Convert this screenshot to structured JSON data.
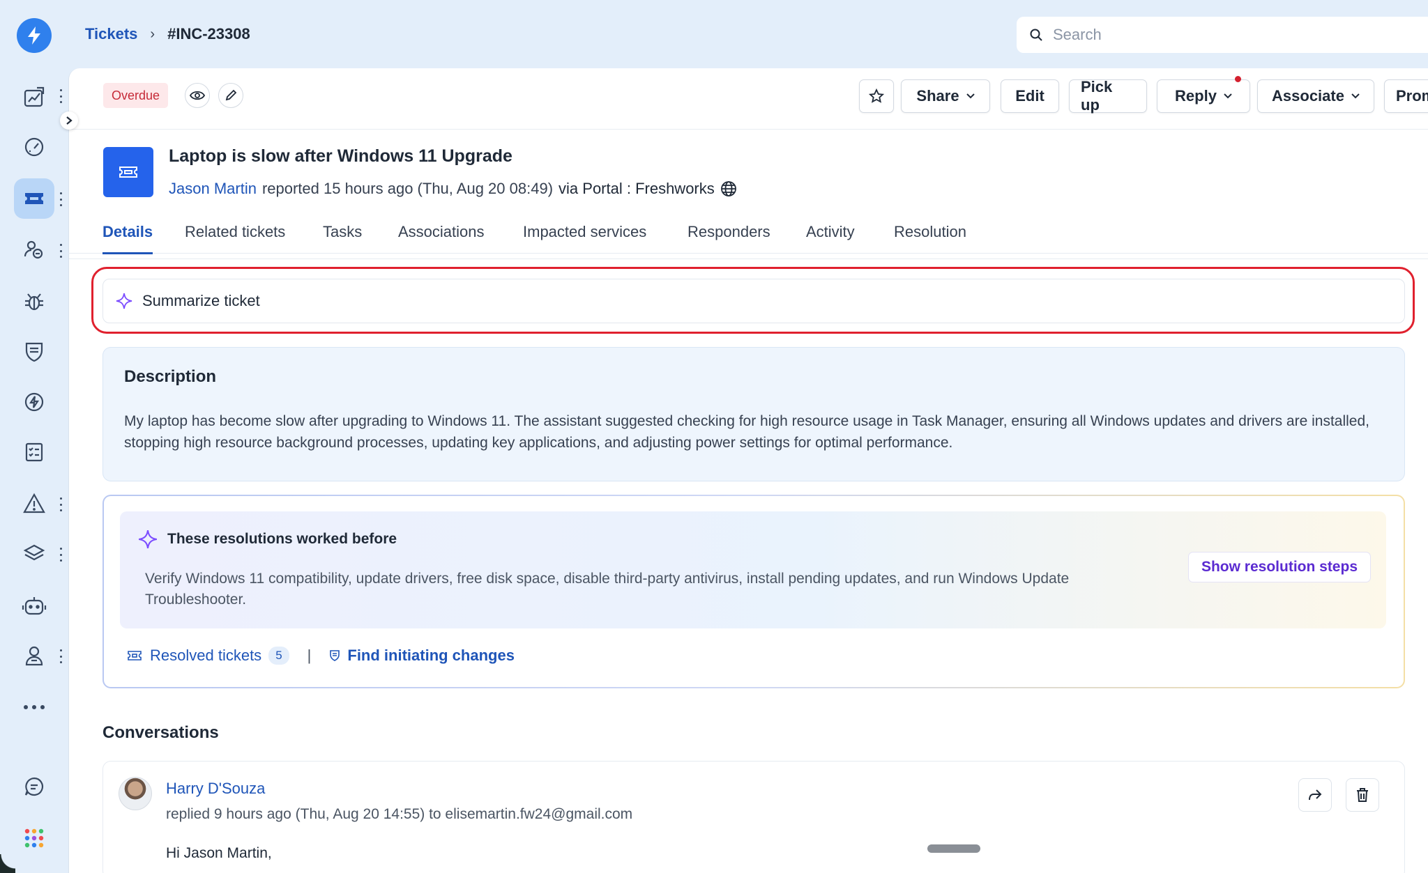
{
  "breadcrumb": {
    "root": "Tickets",
    "separator": "›",
    "current": "#INC-23308"
  },
  "search": {
    "placeholder": "Search"
  },
  "sidebar": {
    "items": [
      {
        "icon": "analytics-icon"
      },
      {
        "icon": "dashboard-icon"
      },
      {
        "icon": "tickets-icon"
      },
      {
        "icon": "users-icon"
      },
      {
        "icon": "problems-icon"
      },
      {
        "icon": "changes-icon"
      },
      {
        "icon": "releases-icon"
      },
      {
        "icon": "tasks-icon"
      },
      {
        "icon": "incidents-icon"
      },
      {
        "icon": "assets-icon"
      },
      {
        "icon": "bot-icon"
      },
      {
        "icon": "solutions-icon"
      },
      {
        "icon": "more-icon"
      },
      {
        "icon": "chat-icon"
      },
      {
        "icon": "apps-icon"
      }
    ]
  },
  "actionbar": {
    "status_badge": "Overdue",
    "share": "Share",
    "edit": "Edit",
    "pickup": "Pick up",
    "reply": "Reply",
    "associate": "Associate",
    "promote": "Prom"
  },
  "ticket": {
    "title": "Laptop is slow after Windows 11 Upgrade",
    "requester": "Jason Martin",
    "reported": "reported 15 hours ago (Thu, Aug 20 08:49)",
    "via": "via Portal : Freshworks"
  },
  "tabs": [
    "Details",
    "Related tickets",
    "Tasks",
    "Associations",
    "Impacted services",
    "Responders",
    "Activity",
    "Resolution"
  ],
  "summarize": {
    "label": "Summarize ticket"
  },
  "description": {
    "title": "Description",
    "body": "My laptop has become slow after upgrading to Windows 11. The assistant suggested checking for high resource usage in Task Manager, ensuring all Windows updates and drivers are installed, stopping high resource background processes, updating key applications, and adjusting power settings for optimal performance."
  },
  "resolutions": {
    "title": "These resolutions worked before",
    "body": "Verify Windows 11 compatibility, update drivers, free disk space, disable third-party antivirus, install pending updates, and run Windows Update Troubleshooter.",
    "button": "Show resolution steps",
    "resolved_label": "Resolved tickets",
    "resolved_count": "5",
    "separator": "|",
    "find_changes": "Find initiating changes"
  },
  "conversations": {
    "title": "Conversations",
    "entry": {
      "name": "Harry D'Souza",
      "meta": "replied 9 hours ago (Thu, Aug 20 14:55) to elisemartin.fw24@gmail.com",
      "greeting": "Hi Jason Martin,"
    }
  },
  "colors": {
    "accent": "#1f55b8",
    "brand_blue": "#2f80ed",
    "overdue_red": "#c62a38",
    "highlight_red": "#e0212e",
    "ai_purple": "#5b2bd1"
  }
}
